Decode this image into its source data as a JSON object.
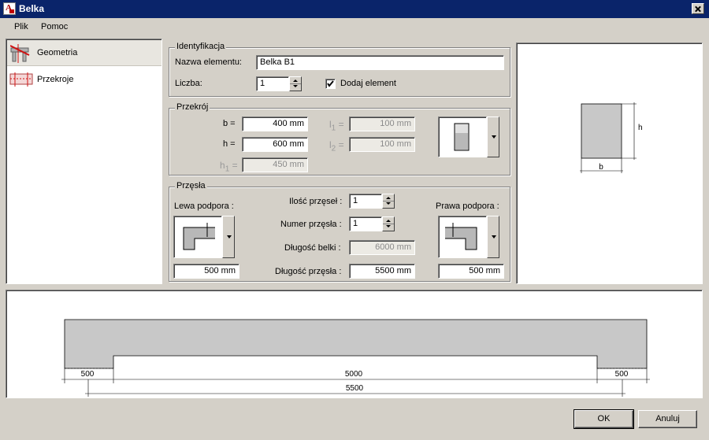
{
  "window": {
    "title": "Belka"
  },
  "menu": {
    "items": [
      "Plik",
      "Pomoc"
    ]
  },
  "nav": {
    "items": [
      {
        "label": "Geometria",
        "icon": "beam-geometry-icon",
        "selected": true
      },
      {
        "label": "Przekroje",
        "icon": "section-icon",
        "selected": false
      }
    ]
  },
  "identyfikacja": {
    "title": "Identyfikacja",
    "name_label": "Nazwa elementu:",
    "name_value": "Belka B1",
    "count_label": "Liczba:",
    "count_value": "1",
    "add_label": "Dodaj element",
    "add_checked": true
  },
  "przekroj": {
    "title": "Przekrój",
    "b_label": "b =",
    "b_value": "400 mm",
    "h_label": "h =",
    "h_value": "600 mm",
    "h1_label": "h",
    "h1_sub": "1",
    "h1_eq": "=",
    "h1_value": "450 mm",
    "l1_label": "l",
    "l1_sub": "1",
    "l1_eq": "=",
    "l1_value": "100 mm",
    "l2_label": "l",
    "l2_sub": "2",
    "l2_eq": "=",
    "l2_value": "100 mm",
    "section_type_icon": "rectangular-section-icon"
  },
  "przesla": {
    "title": "Przęsła",
    "left_support_label": "Lewa podpora :",
    "right_support_label": "Prawa podpora :",
    "left_support_icon": "left-support-icon",
    "right_support_icon": "right-support-icon",
    "left_support_value": "500 mm",
    "right_support_value": "500 mm",
    "span_count_label": "Ilość przęseł :",
    "span_count_value": "1",
    "span_number_label": "Numer przęsła :",
    "span_number_value": "1",
    "beam_length_label": "Długość belki :",
    "beam_length_value": "6000 mm",
    "span_length_label": "Długość przęsła :",
    "span_length_value": "5500 mm"
  },
  "preview": {
    "b_label": "b",
    "h_label": "h"
  },
  "beam_preview": {
    "left_support": "500",
    "span": "5000",
    "right_support": "500",
    "total": "5500"
  },
  "buttons": {
    "ok": "OK",
    "cancel": "Anuluj"
  },
  "colors": {
    "titlebar": "#0a246a",
    "face": "#d4d0c8",
    "section_fill": "#c8c8c8"
  }
}
